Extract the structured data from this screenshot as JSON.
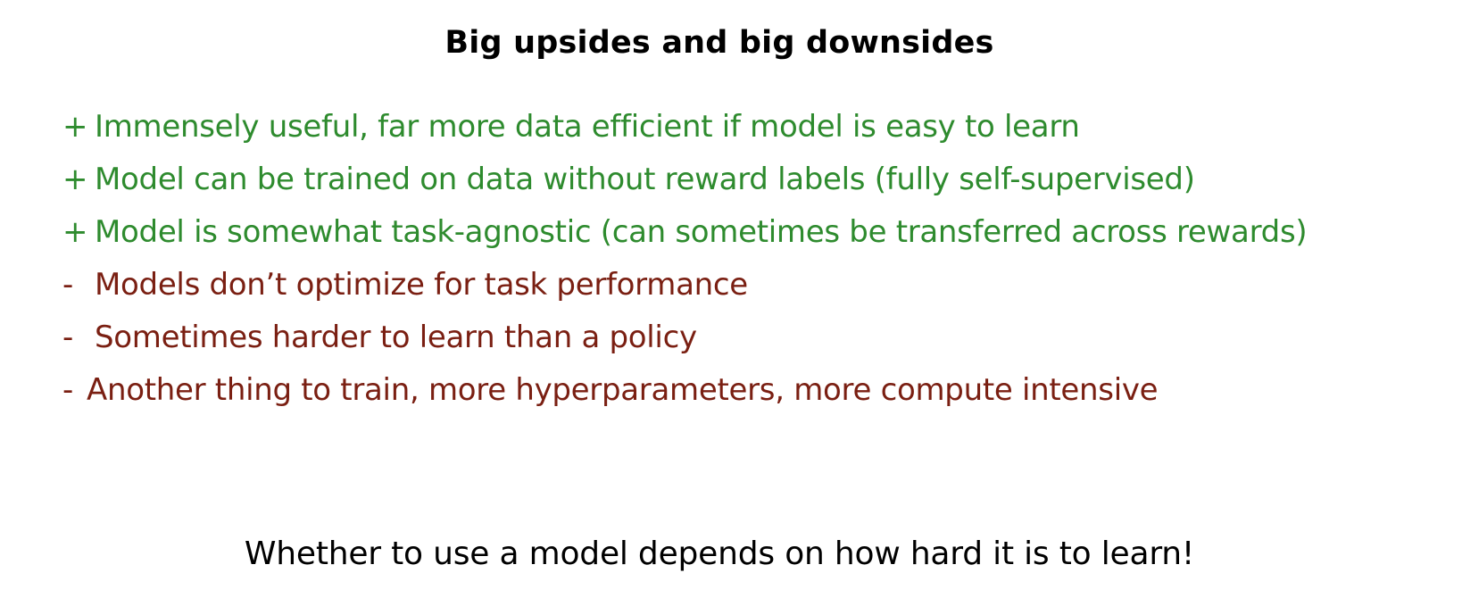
{
  "slide": {
    "title": "Big upsides and big downsides",
    "colors": {
      "pro": "#2e8b2e",
      "con": "#7a1f12",
      "text": "#000000",
      "background": "#ffffff"
    },
    "pros": [
      {
        "marker": "+",
        "text": "Immensely useful, far more data efficient if model is easy to learn"
      },
      {
        "marker": "+",
        "text": "Model can be trained on data without reward labels (fully self-supervised)"
      },
      {
        "marker": "+",
        "text": "Model is somewhat task-agnostic (can sometimes be transferred across rewards)"
      }
    ],
    "cons": [
      {
        "marker": "-",
        "text": "Models don’t optimize for task performance"
      },
      {
        "marker": "-",
        "text": "Sometimes harder to learn than a policy"
      },
      {
        "marker": "-",
        "text": "Another thing to train, more hyperparameters, more compute intensive"
      }
    ],
    "conclusion": "Whether to use a model depends on how hard it is to learn!"
  }
}
